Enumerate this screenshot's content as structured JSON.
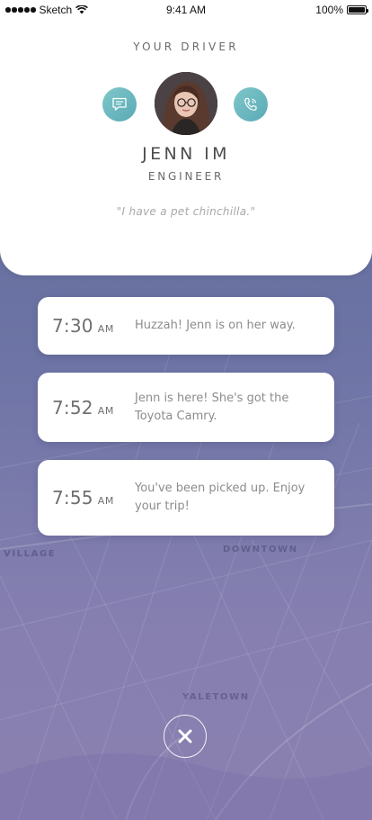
{
  "status_bar": {
    "carrier": "Sketch",
    "time": "9:41 AM",
    "battery": "100%"
  },
  "driver": {
    "heading": "YOUR DRIVER",
    "name": "JENN IM",
    "role": "ENGINEER",
    "quote": "\"I have a pet chinchilla.\""
  },
  "events": [
    {
      "time": "7:30",
      "period": "AM",
      "text": "Huzzah! Jenn is on her way."
    },
    {
      "time": "7:52",
      "period": "AM",
      "text": "Jenn is here! She's got the Toyota Camry."
    },
    {
      "time": "7:55",
      "period": "AM",
      "text": "You've been picked up. Enjoy your trip!"
    }
  ],
  "map": {
    "labels": [
      "DOWNTOWN",
      "YALETOWN",
      "VILLAGE"
    ]
  },
  "colors": {
    "accent_teal": "#6cbac1",
    "map_top": "#5b6796",
    "map_bottom": "#8b80b0"
  },
  "icons": {
    "message": "chat-bubble-icon",
    "call": "phone-icon",
    "close": "close-icon"
  }
}
